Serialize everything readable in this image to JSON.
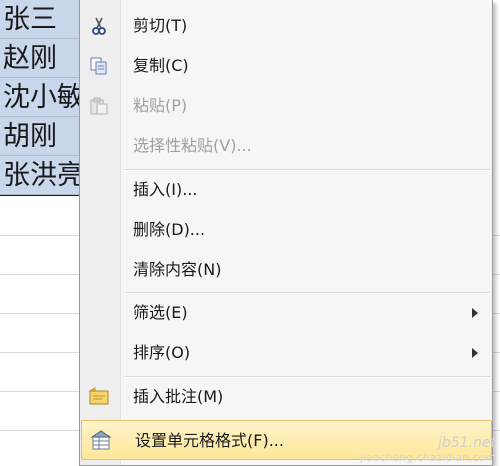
{
  "sheet": {
    "cells": [
      "张三",
      "赵刚",
      "沈小敏",
      "胡刚",
      "张洪亮"
    ]
  },
  "menu": {
    "items": [
      {
        "label": "剪切(T)",
        "icon": "scissors-icon",
        "disabled": false
      },
      {
        "label": "复制(C)",
        "icon": "copy-icon",
        "disabled": false
      },
      {
        "label": "粘贴(P)",
        "icon": "paste-icon",
        "disabled": true
      },
      {
        "label": "选择性粘贴(V)...",
        "icon": "",
        "disabled": true
      },
      {
        "label": "插入(I)...",
        "icon": "",
        "disabled": false
      },
      {
        "label": "删除(D)...",
        "icon": "",
        "disabled": false
      },
      {
        "label": "清除内容(N)",
        "icon": "",
        "disabled": false
      },
      {
        "label": "筛选(E)",
        "icon": "",
        "disabled": false,
        "submenu": true
      },
      {
        "label": "排序(O)",
        "icon": "",
        "disabled": false,
        "submenu": true
      },
      {
        "label": "插入批注(M)",
        "icon": "comment-icon",
        "disabled": false
      },
      {
        "label": "设置单元格格式(F)...",
        "icon": "format-cells-icon",
        "disabled": false,
        "highlighted": true
      }
    ]
  },
  "watermark": {
    "line1": "jb51.net",
    "line2": "jiaocheng.chazidian.com"
  }
}
